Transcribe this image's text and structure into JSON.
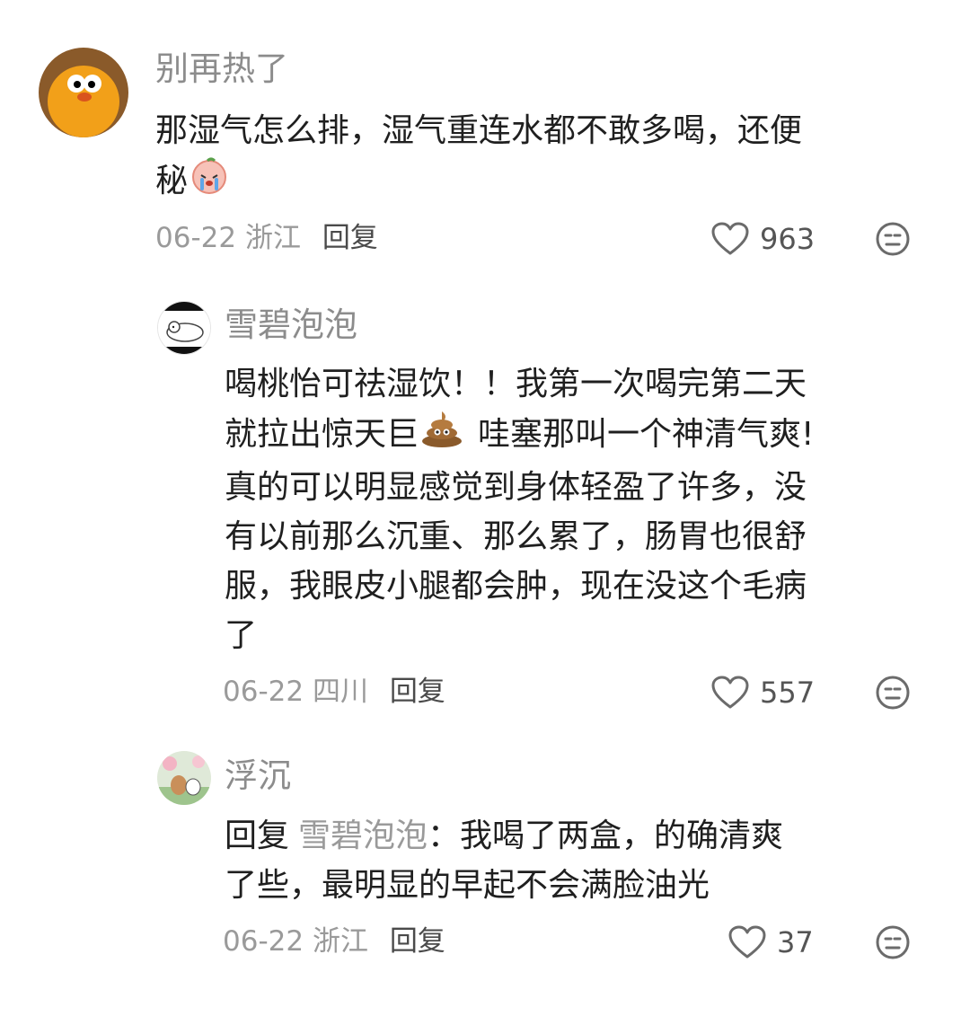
{
  "comments": [
    {
      "username": "别再热了",
      "lines": [
        "那湿气怎么排，湿气重连水都不敢多喝，还便",
        "秘"
      ],
      "date": "06-22",
      "location": "浙江",
      "reply_label": "回复",
      "likes": "963",
      "inline_emoji": "crying-peach-emoji"
    },
    {
      "username": "雪碧泡泡",
      "lines": [
        "喝桃怡可祛湿饮！！我第一次喝完第二天",
        "就拉出惊天巨",
        "哇塞那叫一个神清气爽!",
        "真的可以明显感觉到身体轻盈了许多，没",
        "有以前那么沉重、那么累了，肠胃也很舒",
        "服，我眼皮小腿都会肿，现在没这个毛病",
        "了"
      ],
      "date": "06-22",
      "location": "四川",
      "reply_label": "回复",
      "likes": "557",
      "inline_emoji": "poop-emoji"
    },
    {
      "username": "浮沉",
      "reply_prefix": "回复",
      "mention": "雪碧泡泡",
      "line1_rest": "：我喝了两盒，的确清爽",
      "line2": "了些，最明显的早起不会满脸油光",
      "date": "06-22",
      "location": "浙江",
      "reply_label": "回复",
      "likes": "37"
    }
  ],
  "colors": {
    "username": "#8c8c8c",
    "content": "#1f1f1f",
    "meta": "#9a9a9a",
    "icon": "#6b6b6b"
  }
}
